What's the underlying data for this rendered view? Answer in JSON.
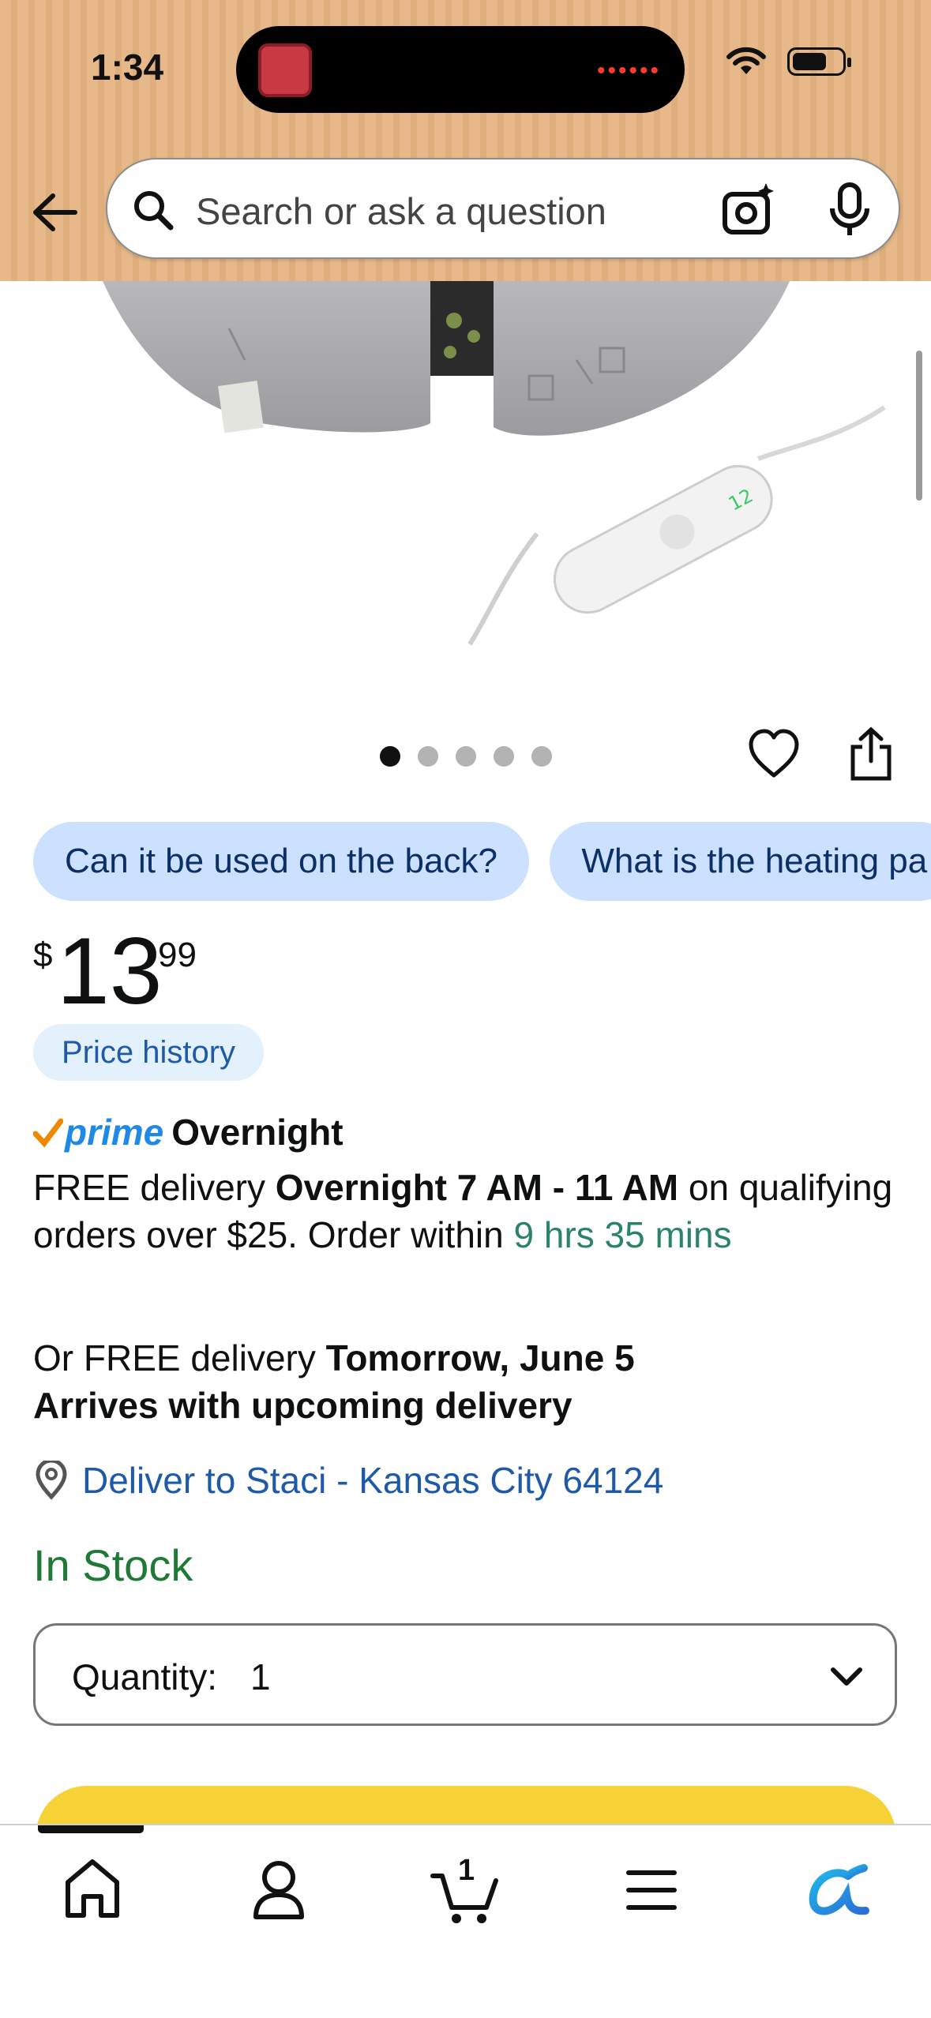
{
  "status_bar": {
    "time": "1:34"
  },
  "search": {
    "placeholder": "Search or ask a question"
  },
  "carousel": {
    "count": 5,
    "active_index": 0
  },
  "questions": [
    "Can it be used on the back?",
    "What is the heating pa"
  ],
  "price": {
    "currency": "$",
    "whole": "13",
    "fraction": "99"
  },
  "price_history_label": "Price history",
  "prime": {
    "word": "prime",
    "label": "Overnight"
  },
  "delivery": {
    "part1": "FREE delivery ",
    "bold": "Overnight 7 AM - 11 AM",
    "part2": " on qualifying orders over $25. Order within ",
    "countdown": "9 hrs 35 mins"
  },
  "alt_delivery": {
    "prefix": "Or FREE delivery ",
    "date": "Tomorrow, June 5",
    "line2": "Arrives with upcoming delivery"
  },
  "deliver_to": "Deliver to Staci - Kansas City 64124",
  "stock": "In Stock",
  "quantity": {
    "label": "Quantity:",
    "value": "1"
  },
  "bottom_nav": {
    "cart_count": "1",
    "items": [
      "home-icon",
      "account-icon",
      "cart-icon",
      "menu-icon",
      "rufus-icon"
    ]
  },
  "colors": {
    "header_bg": "#e7b98a",
    "chip_bg": "#cce0ff",
    "stock_green": "#1e7a36",
    "link_blue": "#1f5aa8",
    "buy_yellow": "#f6d236"
  }
}
